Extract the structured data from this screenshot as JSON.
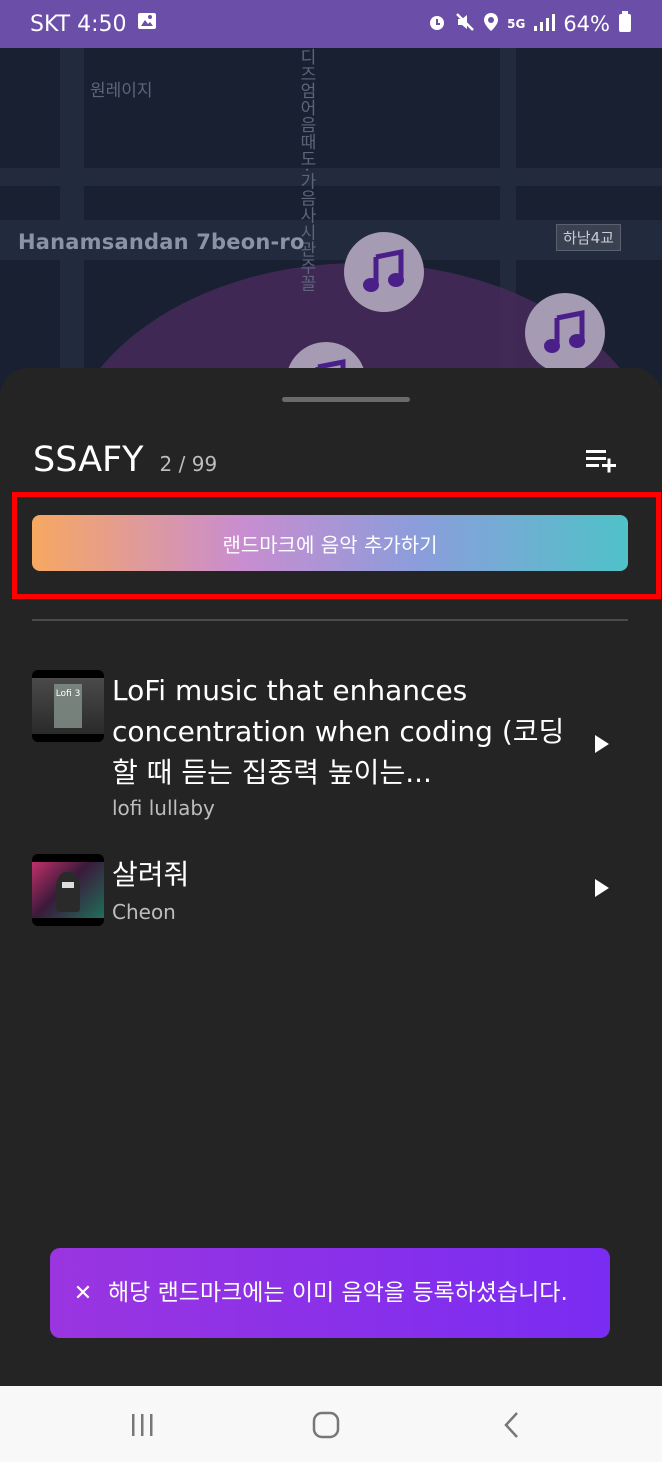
{
  "status_bar": {
    "carrier_time": "SKT 4:50",
    "network": "5G",
    "battery": "64%"
  },
  "map": {
    "street_label": "Hanamsandan 7beon-ro",
    "poi_label": "원레이지",
    "vertical_label": "디즈엄어음때도·가음사시관주꼴",
    "bridge_label": "하남4교"
  },
  "sheet": {
    "title": "SSAFY",
    "count": "2 / 99",
    "add_button_label": "랜드마크에 음악 추가하기",
    "tracks": [
      {
        "title": "LoFi music that enhances concentration when coding (코딩할 때 듣는 집중력 높이는...",
        "artist": "lofi lullaby",
        "thumb_text": "Lofi 3"
      },
      {
        "title": "살려줘",
        "artist": "Cheon"
      }
    ]
  },
  "toast": {
    "close_label": "✕",
    "message": "해당 랜드마크에는 이미 음악을 등록하셨습니다."
  },
  "colors": {
    "status_bar": "#6b4ea7",
    "sheet_bg": "#242424",
    "highlight": "#ff0000",
    "toast": "#8a2be2",
    "pin": "#a59bb3",
    "note": "#4b1f8a"
  }
}
